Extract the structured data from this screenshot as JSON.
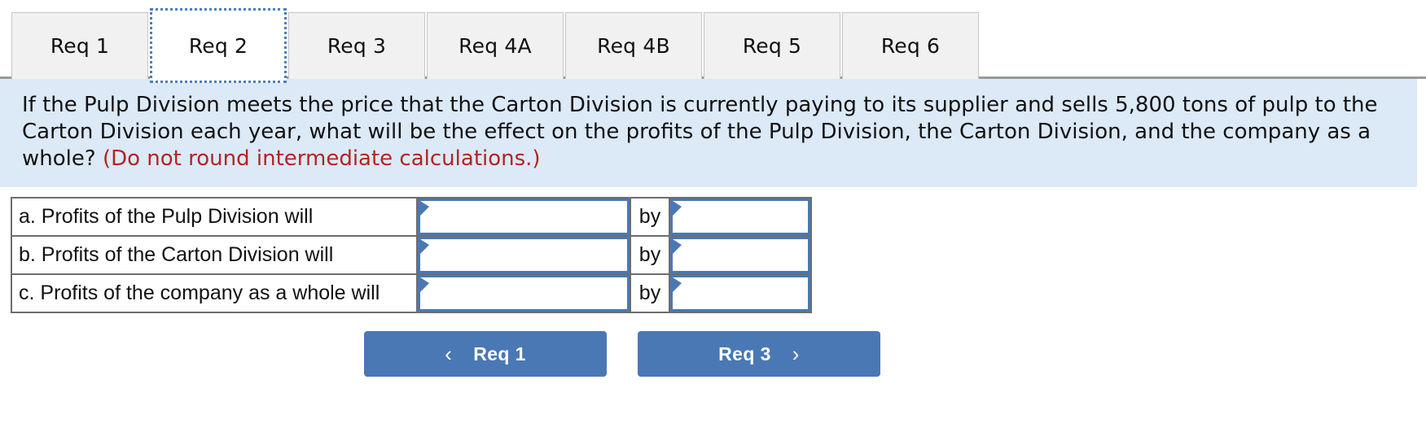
{
  "tabs": [
    {
      "label": "Req 1",
      "active": false
    },
    {
      "label": "Req 2",
      "active": true
    },
    {
      "label": "Req 3",
      "active": false
    },
    {
      "label": "Req 4A",
      "active": false
    },
    {
      "label": "Req 4B",
      "active": false
    },
    {
      "label": "Req 5",
      "active": false
    },
    {
      "label": "Req 6",
      "active": false
    }
  ],
  "question": {
    "body": "If the Pulp Division meets the price that the Carton Division is currently paying to its supplier and sells 5,800 tons of pulp to the Carton Division each year, what will be the effect on the profits of the Pulp Division, the Carton Division, and the company as a whole? ",
    "note": "(Do not round intermediate calculations.)",
    "note_color": "#b22424",
    "panel_color": "#dce9f7"
  },
  "answer_table": {
    "connector_label": "by",
    "rows": [
      {
        "label": "a. Profits of the Pulp Division will",
        "effect_value": "",
        "effect_placeholder": "",
        "amount_value": "",
        "amount_placeholder": ""
      },
      {
        "label": "b. Profits of the Carton Division will",
        "effect_value": "",
        "effect_placeholder": "",
        "amount_value": "",
        "amount_placeholder": ""
      },
      {
        "label": "c. Profits of the company as a whole will",
        "effect_value": "",
        "effect_placeholder": "",
        "amount_value": "",
        "amount_placeholder": ""
      }
    ]
  },
  "navigation": {
    "prev": {
      "label": "Req 1",
      "chevron": "‹",
      "icon": "chevron-left-icon"
    },
    "next": {
      "label": "Req 3",
      "chevron": "›",
      "icon": "chevron-right-icon"
    },
    "accent_color": "#4a78b5"
  }
}
